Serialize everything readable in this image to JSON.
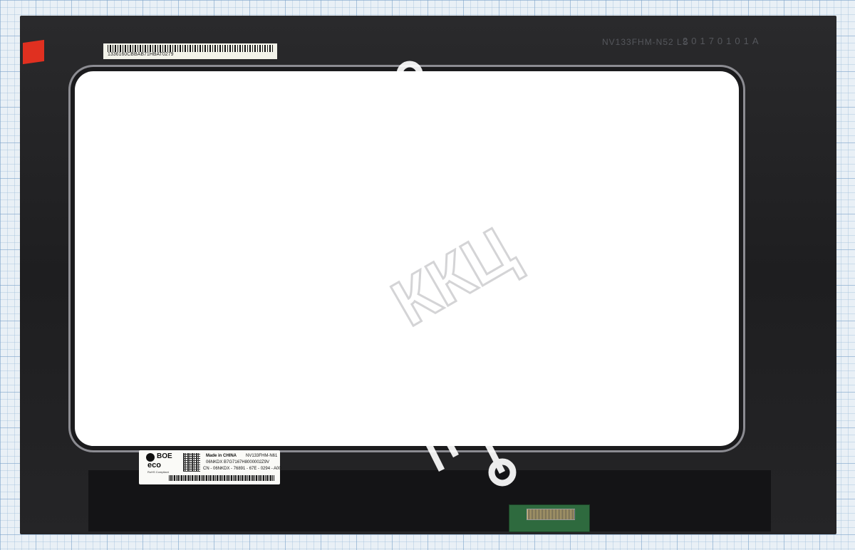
{
  "panel": {
    "sticker_barcode_text": "1336160CBBAB71HBAT0279",
    "model_print": "NV133FHM-N52 LS",
    "date_print": "20170101A"
  },
  "label": {
    "brand": "BOE",
    "eco": "eco",
    "rohs": "RoHS Compliant",
    "made_in": "Made in CHINA",
    "model": "NV133FHM-N61",
    "ppid": "06NKDX  B7G7167H8000002Z9V",
    "cn_code": "CN - 06NKDX - 76891 - 67E - 0294 - A00"
  },
  "watermark": {
    "text": "ККЦ"
  },
  "colors": {
    "panel_black": "#1e1e20",
    "screen_white": "#ffffff",
    "tab_red": "#e03020",
    "connector_green": "#2e6a3e"
  }
}
